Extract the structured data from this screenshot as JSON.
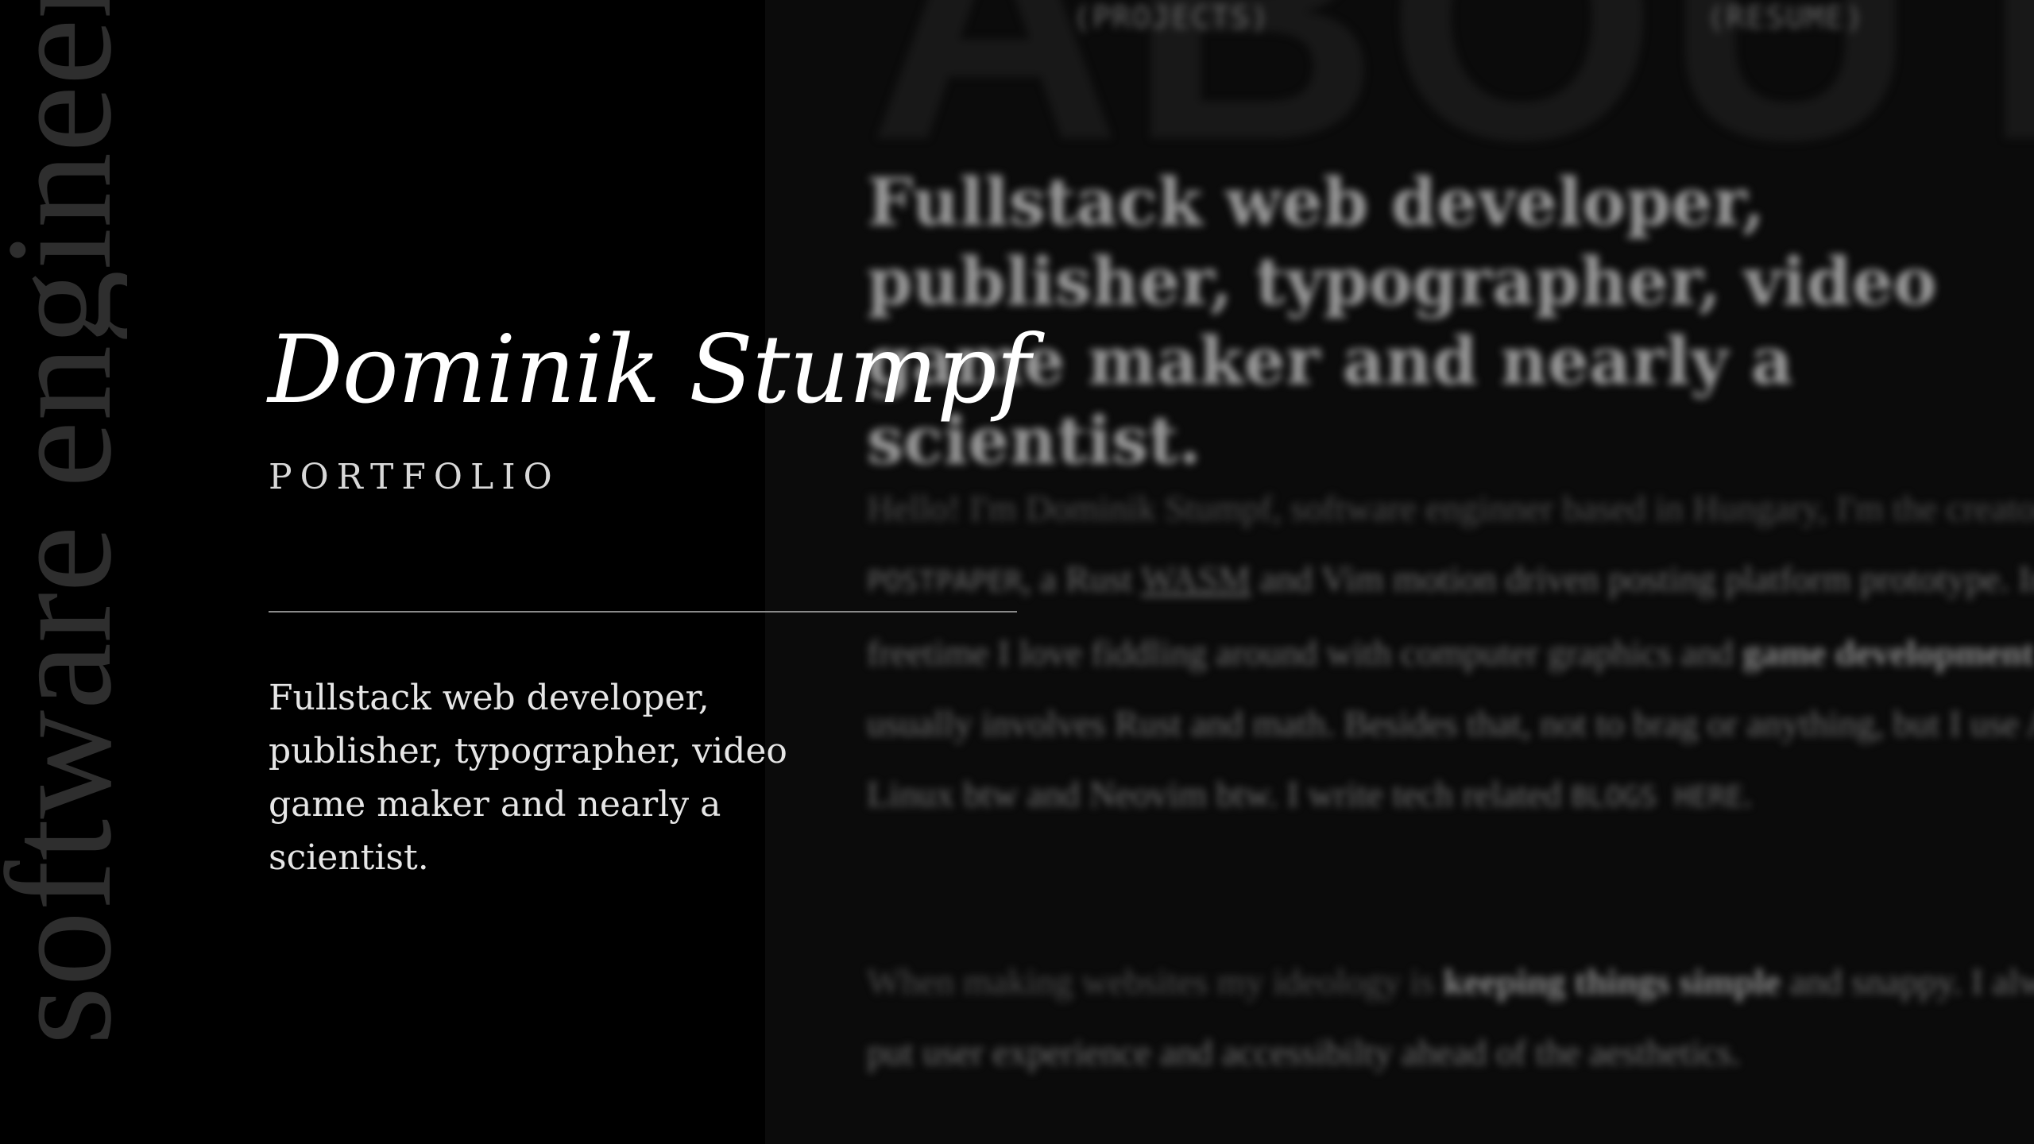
{
  "background_page": {
    "nav": {
      "projects": "(PROJECTS)",
      "resume": "(RESUME)"
    },
    "watermark": "ABOUT",
    "headline": "Fullstack web developer, publisher, typographer, video game maker and nearly a scientist.",
    "para1": {
      "t1": "Hello! I'm Dominik Stumpf, software enginner based in Hungary, I'm the creator of ",
      "postpaper": "POSTPAPER",
      "t2": ", a Rust ",
      "wasm": "WASM",
      "t3": " and Vim motion driven posting platform prototype. In my freetime I love fiddling around with computer graphics and ",
      "gamedev": "game development",
      "t4": " that usually involves Rust and math. Besides that, not to brag or anything, but I use Arch Linux btw and Neovim btw. I write tech related ",
      "blogs": "BLOGS HERE",
      "t5": "."
    },
    "para2": {
      "t1": "When making websites my ideology is ",
      "simple": "keeping things simple",
      "t2": " and snappy. I always put user experience and accessibilty ahead of the aesthetics."
    }
  },
  "side_text": "software engineer",
  "hero": {
    "name": "Dominik Stumpf",
    "subtitle": "PORTFOLIO",
    "tagline": "Fullstack web developer, publisher, typographer, video game maker and nearly a scientist."
  }
}
